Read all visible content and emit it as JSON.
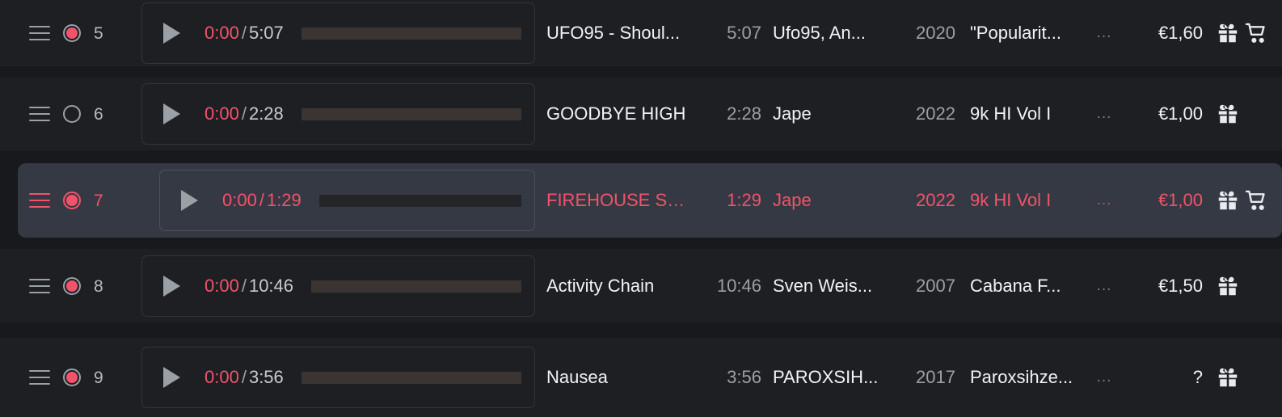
{
  "view": {
    "name": "track-list",
    "accent_color": "#f2536a",
    "row_background": "#1d1f23",
    "selected_row_background": "#353943",
    "page_background": "#17191c"
  },
  "columns": {
    "handle": "drag-handle",
    "state": "state-dot",
    "index": "index",
    "player": "player",
    "title": "title",
    "duration": "duration",
    "artist": "artist",
    "year": "year",
    "album": "album",
    "more": "more",
    "price": "price",
    "actions": "actions"
  },
  "icons": {
    "drag_handle": "drag-handle-icon",
    "state_filled": "record-filled-icon",
    "state_empty": "record-empty-icon",
    "play": "play-icon",
    "gift": "gift-icon",
    "cart": "cart-icon",
    "more": "ellipsis-icon"
  },
  "labels": {
    "more": "...",
    "time_separator": "/"
  },
  "rows": [
    {
      "index": "5",
      "state": "filled",
      "selected": false,
      "current_time": "0:00",
      "duration": "5:07",
      "progress_percent": 0,
      "title": "UFO95 - Shoul...",
      "length": "5:07",
      "artist": "Ufo95, An...",
      "year": "2020",
      "album": "\"Popularit...",
      "more": "...",
      "price": "€1,60",
      "has_gift": true,
      "has_cart": true
    },
    {
      "index": "6",
      "state": "empty",
      "selected": false,
      "current_time": "0:00",
      "duration": "2:28",
      "progress_percent": 0,
      "title": "GOODBYE HIGH",
      "length": "2:28",
      "artist": "Jape",
      "year": "2022",
      "album": "9k HI Vol I",
      "more": "...",
      "price": "€1,00",
      "has_gift": true,
      "has_cart": false
    },
    {
      "index": "7",
      "state": "filled",
      "selected": true,
      "current_time": "0:00",
      "duration": "1:29",
      "progress_percent": 0,
      "title": "FIREHOUSE SK...",
      "length": "1:29",
      "artist": "Jape",
      "year": "2022",
      "album": "9k HI Vol I",
      "more": "...",
      "price": "€1,00",
      "has_gift": true,
      "has_cart": true
    },
    {
      "index": "8",
      "state": "filled",
      "selected": false,
      "current_time": "0:00",
      "duration": "10:46",
      "progress_percent": 0,
      "title": "Activity Chain",
      "length": "10:46",
      "artist": "Sven Weis...",
      "year": "2007",
      "album": "Cabana F...",
      "more": "...",
      "price": "€1,50",
      "has_gift": true,
      "has_cart": false
    },
    {
      "index": "9",
      "state": "filled",
      "selected": false,
      "current_time": "0:00",
      "duration": "3:56",
      "progress_percent": 0,
      "title": "Nausea",
      "length": "3:56",
      "artist": "PAROXSIH...",
      "year": "2017",
      "album": "Paroxsihze...",
      "more": "...",
      "price": "?",
      "has_gift": true,
      "has_cart": false
    }
  ]
}
